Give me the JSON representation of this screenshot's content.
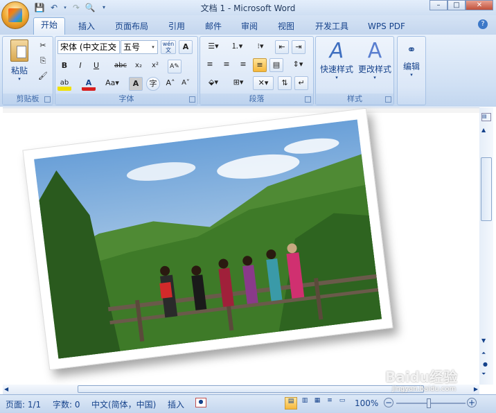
{
  "window": {
    "title": "文档 1 - Microsoft Word",
    "controls": {
      "minimize": "–",
      "maximize": "□",
      "close": "✕"
    }
  },
  "quick_access": [
    "save-icon",
    "undo-icon",
    "redo-icon",
    "print-preview-icon",
    "customize-icon"
  ],
  "tabs": [
    {
      "label": "开始",
      "active": true
    },
    {
      "label": "插入"
    },
    {
      "label": "页面布局"
    },
    {
      "label": "引用"
    },
    {
      "label": "邮件"
    },
    {
      "label": "审阅"
    },
    {
      "label": "视图"
    },
    {
      "label": "开发工具"
    },
    {
      "label": "WPS PDF"
    }
  ],
  "ribbon": {
    "clipboard": {
      "paste_label": "粘贴",
      "group_label": "剪贴板"
    },
    "font": {
      "font_name": "宋体 (中文正文",
      "font_size": "五号",
      "group_label": "字体"
    },
    "paragraph": {
      "group_label": "段落"
    },
    "styles": {
      "quick_styles_label": "快速样式",
      "change_styles_label": "更改样式",
      "group_label": "样式"
    },
    "editing": {
      "label": "编辑"
    }
  },
  "status": {
    "page": "页面: 1/1",
    "words": "字数: 0",
    "language": "中文(简体，中国)",
    "mode": "插入",
    "zoom": "100%"
  },
  "watermark": {
    "text": "Baidu经验",
    "url": "jingyan.baidu.com"
  },
  "colors": {
    "accent": "#15428b",
    "ribbon_bg": "#dbe7f7",
    "highlight": "#f0c000",
    "font_red": "#d81e1e"
  }
}
